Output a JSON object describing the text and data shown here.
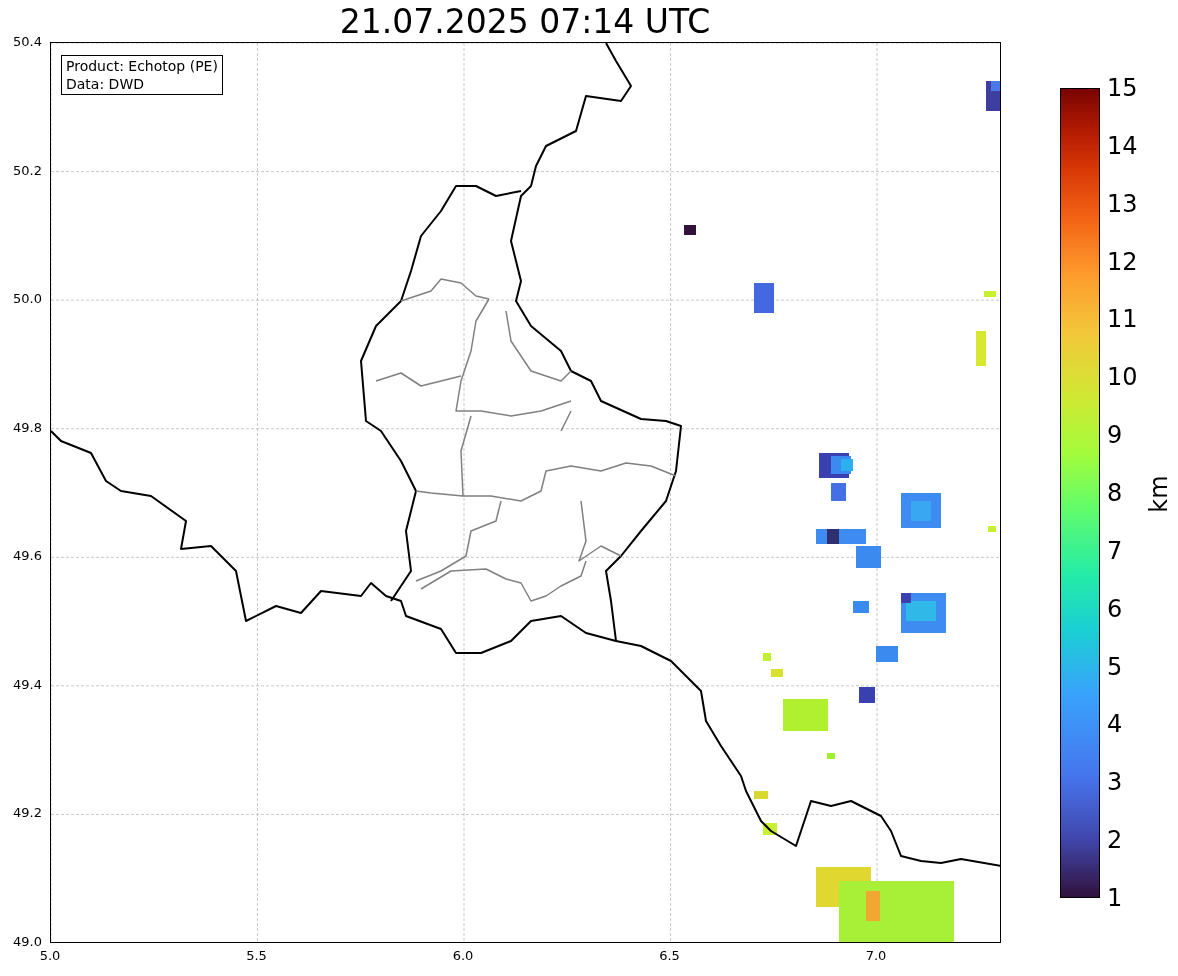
{
  "title": "21.07.2025 07:14 UTC",
  "info_box": [
    "Product: Echotop (PE)",
    "Data: DWD"
  ],
  "map": {
    "x_ticks": [
      "5.0",
      "5.5",
      "6.0",
      "6.5",
      "7.0"
    ],
    "y_ticks": [
      "50.4",
      "50.2",
      "50.0",
      "49.8",
      "49.6",
      "49.4",
      "49.2",
      "49.0"
    ]
  },
  "colorbar": {
    "label": "km",
    "ticks": [
      "15",
      "14",
      "13",
      "12",
      "11",
      "10",
      "9",
      "8",
      "7",
      "6",
      "5",
      "4",
      "3",
      "2",
      "1"
    ]
  }
}
